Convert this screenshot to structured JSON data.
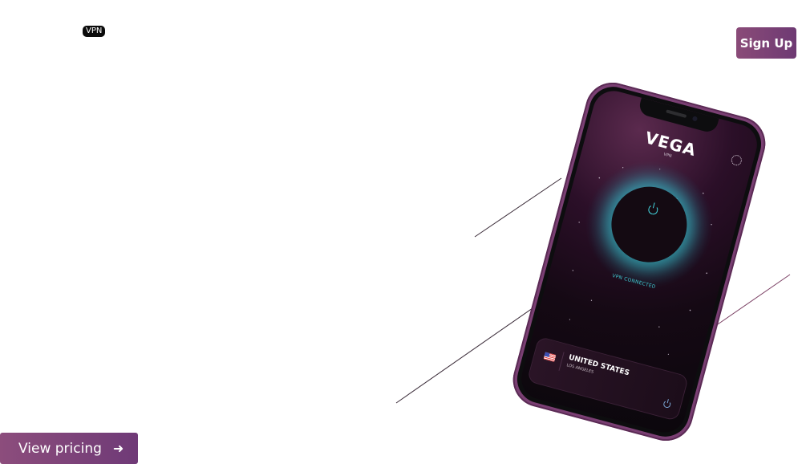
{
  "header": {
    "logo_badge": "VPN",
    "signup_label": "Sign Up"
  },
  "hero": {
    "view_pricing_label": "View pricing",
    "view_pricing_arrow": "➜"
  },
  "phone": {
    "app_name": "VEGA",
    "app_sub": "VPN",
    "status": "VPN CONNECTED",
    "location": {
      "country": "UNITED STATES",
      "city": "LOS ANGELES"
    }
  },
  "colors": {
    "accent": "#7a3f73",
    "glow": "#44d7e0"
  }
}
